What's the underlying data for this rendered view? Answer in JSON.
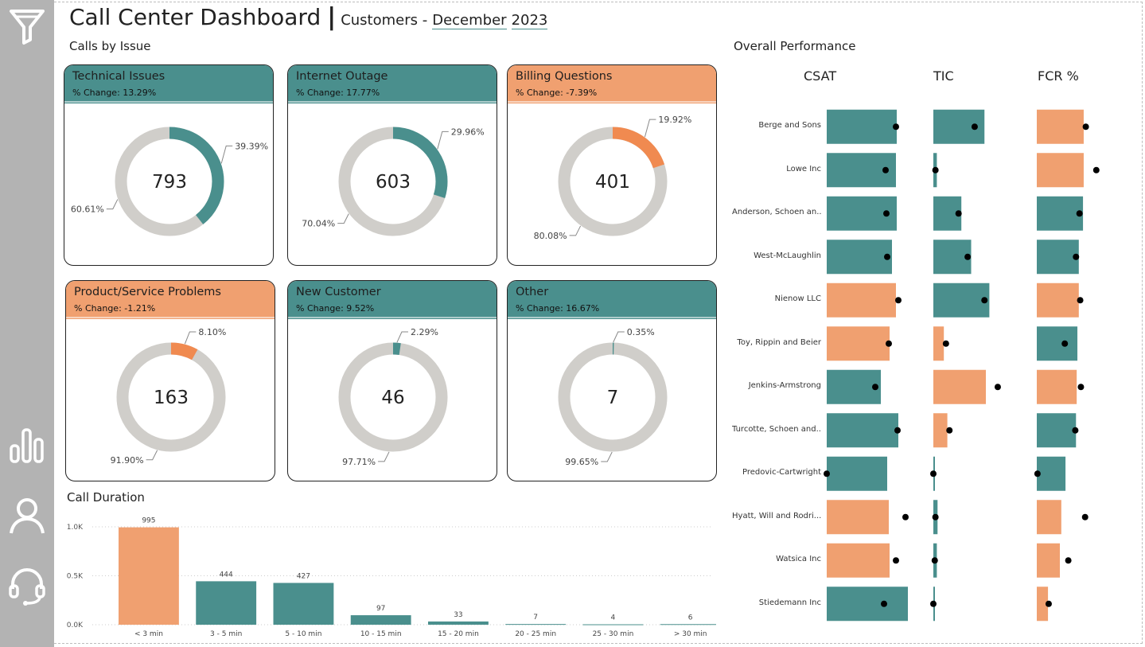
{
  "header": {
    "title": "Call Center Dashboard",
    "separator": "|",
    "subtitle": "Customers - ",
    "month": "December",
    "year": "2023"
  },
  "sections": {
    "calls_by_issue": "Calls by Issue",
    "overall_performance": "Overall Performance",
    "call_duration": "Call Duration"
  },
  "colors": {
    "teal": "#4a8f8d",
    "orange": "#f0a070",
    "orange_accent": "#f08a50",
    "ring_gray": "#d0ceca",
    "sidebar": "#b3b3b3"
  },
  "sidebar": {
    "icons": [
      "filter-icon",
      "bar-chart-icon",
      "user-icon",
      "headset-icon"
    ]
  },
  "issue_cards": [
    {
      "title": "Technical Issues",
      "change": "% Change: 13.29%",
      "total": "793",
      "pct_major": "39.39%",
      "pct_rest": "60.61%",
      "fraction": 0.3939,
      "theme": "teal"
    },
    {
      "title": "Internet Outage",
      "change": "% Change: 17.77%",
      "total": "603",
      "pct_major": "29.96%",
      "pct_rest": "70.04%",
      "fraction": 0.2996,
      "theme": "teal"
    },
    {
      "title": "Billing Questions",
      "change": "% Change: -7.39%",
      "total": "401",
      "pct_major": "19.92%",
      "pct_rest": "80.08%",
      "fraction": 0.1992,
      "theme": "orange"
    },
    {
      "title": "Product/Service Problems",
      "change": "% Change: -1.21%",
      "total": "163",
      "pct_major": "8.10%",
      "pct_rest": "91.90%",
      "fraction": 0.081,
      "theme": "orange"
    },
    {
      "title": "New Customer",
      "change": "% Change: 9.52%",
      "total": "46",
      "pct_major": "2.29%",
      "pct_rest": "97.71%",
      "fraction": 0.0229,
      "theme": "teal"
    },
    {
      "title": "Other",
      "change": "% Change: 16.67%",
      "total": "7",
      "pct_major": "0.35%",
      "pct_rest": "99.65%",
      "fraction": 0.0035,
      "theme": "teal"
    }
  ],
  "performance": {
    "columns": [
      "CSAT",
      "TIC",
      "FCR %"
    ],
    "rows": [
      {
        "name": "Berge and Sons",
        "csat": [
          0.88,
          0.87,
          "teal"
        ],
        "tic": [
          0.73,
          0.59,
          "teal"
        ],
        "fcr": [
          0.67,
          0.7,
          "orange"
        ]
      },
      {
        "name": "Lowe Inc",
        "csat": [
          0.87,
          0.74,
          "teal"
        ],
        "tic": [
          0.05,
          0.03,
          "teal"
        ],
        "fcr": [
          0.67,
          0.85,
          "orange"
        ]
      },
      {
        "name": "Anderson, Schoen an...",
        "csat": [
          0.88,
          0.75,
          "teal"
        ],
        "tic": [
          0.4,
          0.36,
          "teal"
        ],
        "fcr": [
          0.66,
          0.61,
          "teal"
        ]
      },
      {
        "name": "West-McLaughlin",
        "csat": [
          0.82,
          0.76,
          "teal"
        ],
        "tic": [
          0.54,
          0.49,
          "teal"
        ],
        "fcr": [
          0.6,
          0.56,
          "teal"
        ]
      },
      {
        "name": "Nienow LLC",
        "csat": [
          0.87,
          0.9,
          "orange"
        ],
        "tic": [
          0.8,
          0.73,
          "teal"
        ],
        "fcr": [
          0.6,
          0.62,
          "orange"
        ]
      },
      {
        "name": "Toy, Rippin and Beier",
        "csat": [
          0.79,
          0.78,
          "orange"
        ],
        "tic": [
          0.15,
          0.18,
          "orange"
        ],
        "fcr": [
          0.58,
          0.4,
          "teal"
        ]
      },
      {
        "name": "Jenkins-Armstrong",
        "csat": [
          0.68,
          0.61,
          "teal"
        ],
        "tic": [
          0.75,
          0.92,
          "orange"
        ],
        "fcr": [
          0.57,
          0.63,
          "orange"
        ]
      },
      {
        "name": "Turcotte, Schoen and...",
        "csat": [
          0.9,
          0.89,
          "teal"
        ],
        "tic": [
          0.2,
          0.23,
          "orange"
        ],
        "fcr": [
          0.56,
          0.55,
          "teal"
        ]
      },
      {
        "name": "Predovic-Cartwright",
        "csat": [
          0.76,
          0.0,
          "teal"
        ],
        "tic": [
          0.02,
          0.0,
          "teal"
        ],
        "fcr": [
          0.41,
          0.01,
          "teal"
        ]
      },
      {
        "name": "Hyatt, Will and Rodri...",
        "csat": [
          0.78,
          0.99,
          "orange"
        ],
        "tic": [
          0.06,
          0.03,
          "teal"
        ],
        "fcr": [
          0.35,
          0.69,
          "orange"
        ]
      },
      {
        "name": "Watsica Inc",
        "csat": [
          0.79,
          0.87,
          "orange"
        ],
        "tic": [
          0.05,
          0.02,
          "teal"
        ],
        "fcr": [
          0.33,
          0.45,
          "orange"
        ]
      },
      {
        "name": "Stiedemann Inc",
        "csat": [
          1.02,
          0.72,
          "teal"
        ],
        "tic": [
          0.01,
          0.0,
          "teal"
        ],
        "fcr": [
          0.16,
          0.17,
          "orange"
        ]
      }
    ]
  },
  "chart_data": {
    "type": "bar",
    "title": "Call Duration",
    "categories": [
      "< 3 min",
      "3 - 5 min",
      "5 - 10 min",
      "10 - 15 min",
      "15 - 20 min",
      "20 - 25 min",
      "25 - 30 min",
      "> 30 min"
    ],
    "values": [
      995,
      444,
      427,
      97,
      33,
      7,
      4,
      6
    ],
    "value_labels": [
      "995",
      "444",
      "427",
      "97",
      "33",
      "7",
      "4",
      "6"
    ],
    "bar_colors": [
      "#f0a070",
      "#4a8f8d",
      "#4a8f8d",
      "#4a8f8d",
      "#4a8f8d",
      "#4a8f8d",
      "#4a8f8d",
      "#4a8f8d"
    ],
    "yticks": [
      0,
      500,
      1000
    ],
    "ytick_labels": [
      "0.0K",
      "0.5K",
      "1.0K"
    ],
    "ylim": [
      0,
      1000
    ],
    "grid": true,
    "xlabel": "",
    "ylabel": ""
  }
}
